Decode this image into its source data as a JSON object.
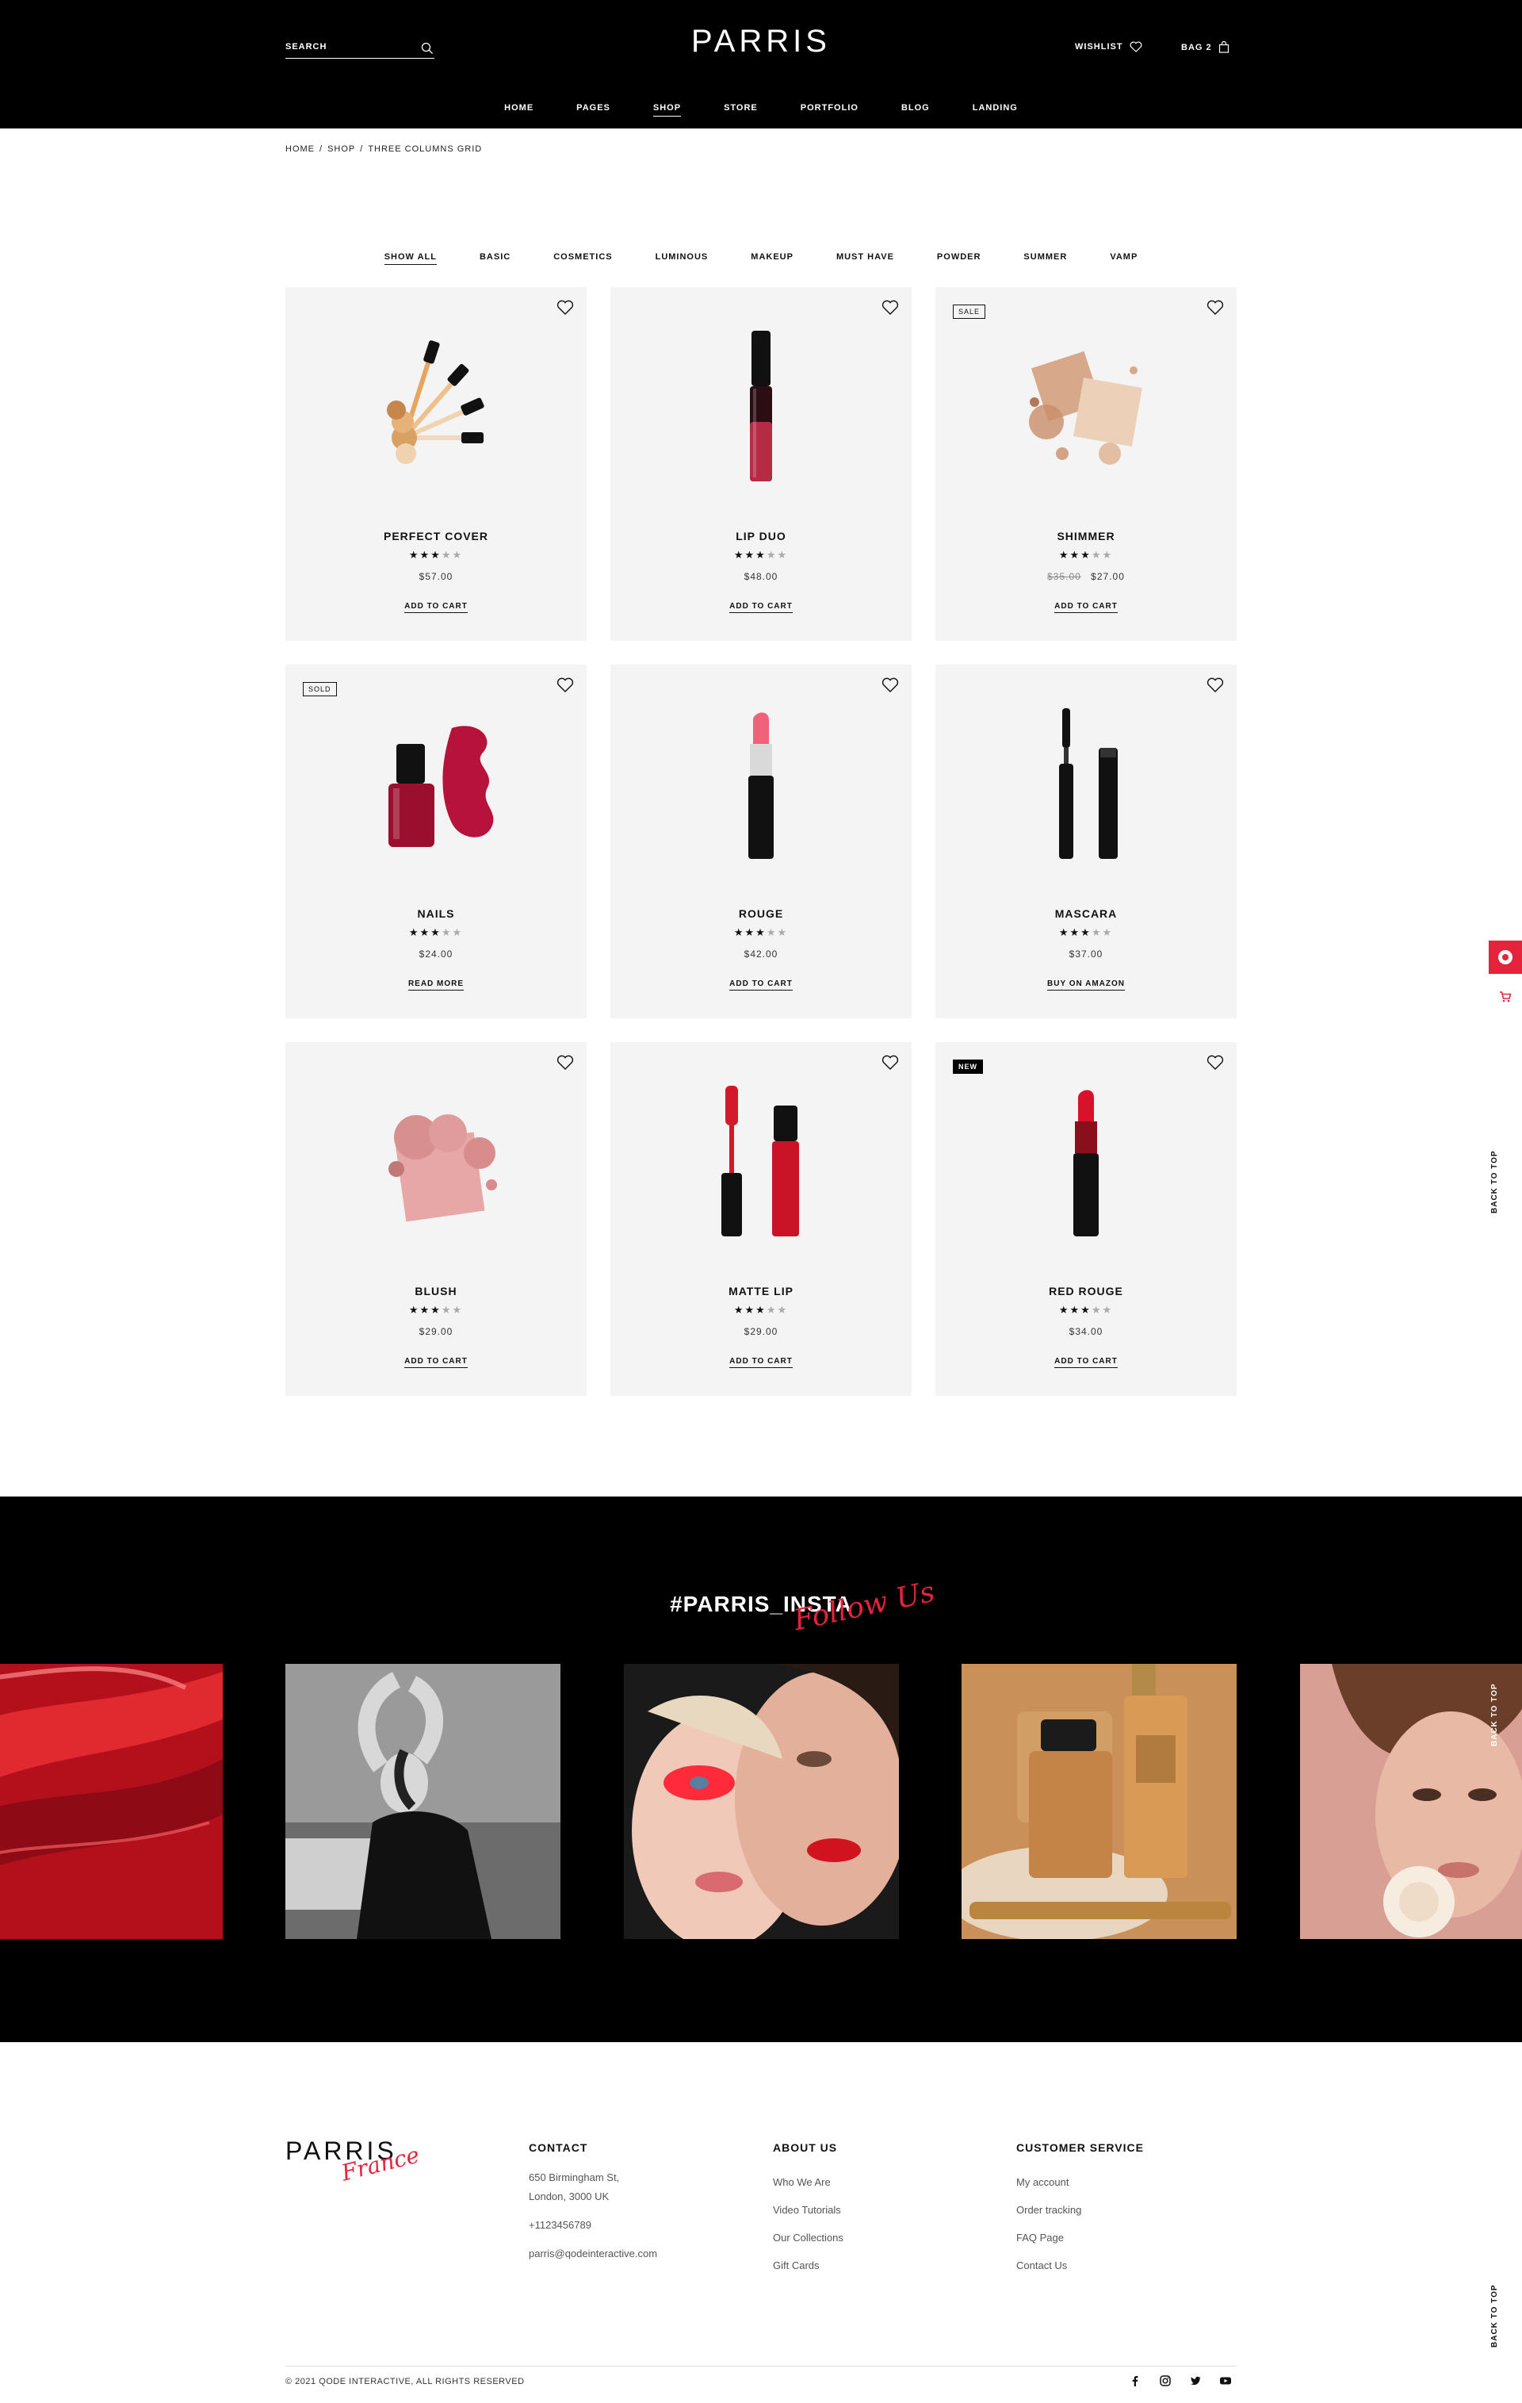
{
  "header": {
    "search_label": "SEARCH",
    "logo": "PARRIS",
    "wishlist_label": "WISHLIST",
    "bag_label": "BAG 2",
    "nav": [
      {
        "label": "HOME",
        "active": false
      },
      {
        "label": "PAGES",
        "active": false
      },
      {
        "label": "SHOP",
        "active": true
      },
      {
        "label": "STORE",
        "active": false
      },
      {
        "label": "PORTFOLIO",
        "active": false
      },
      {
        "label": "BLOG",
        "active": false
      },
      {
        "label": "LANDING",
        "active": false
      }
    ]
  },
  "breadcrumb": [
    "HOME",
    "SHOP",
    "THREE COLUMNS GRID"
  ],
  "filters": [
    {
      "label": "SHOW ALL",
      "active": true
    },
    {
      "label": "BASIC",
      "active": false
    },
    {
      "label": "COSMETICS",
      "active": false
    },
    {
      "label": "LUMINOUS",
      "active": false
    },
    {
      "label": "MAKEUP",
      "active": false
    },
    {
      "label": "MUST HAVE",
      "active": false
    },
    {
      "label": "POWDER",
      "active": false
    },
    {
      "label": "SUMMER",
      "active": false
    },
    {
      "label": "VAMP",
      "active": false
    }
  ],
  "products": [
    {
      "name": "PERFECT COVER",
      "rating": 3,
      "price": "$57.00",
      "old_price": "",
      "action": "ADD TO CART",
      "badge": "",
      "image": "droppers"
    },
    {
      "name": "LIP DUO",
      "rating": 3,
      "price": "$48.00",
      "old_price": "",
      "action": "ADD TO CART",
      "badge": "",
      "image": "lipgloss"
    },
    {
      "name": "SHIMMER",
      "rating": 3,
      "price": "$27.00",
      "old_price": "$35.00",
      "action": "ADD TO CART",
      "badge": "SALE",
      "image": "powder"
    },
    {
      "name": "NAILS",
      "rating": 3,
      "price": "$24.00",
      "old_price": "",
      "action": "READ MORE",
      "badge": "SOLD",
      "image": "nailpolish"
    },
    {
      "name": "ROUGE",
      "rating": 3,
      "price": "$42.00",
      "old_price": "",
      "action": "ADD TO CART",
      "badge": "",
      "image": "lipstick-pink"
    },
    {
      "name": "MASCARA",
      "rating": 3,
      "price": "$37.00",
      "old_price": "",
      "action": "BUY ON AMAZON",
      "badge": "",
      "image": "mascara"
    },
    {
      "name": "BLUSH",
      "rating": 3,
      "price": "$29.00",
      "old_price": "",
      "action": "ADD TO CART",
      "badge": "",
      "image": "blush"
    },
    {
      "name": "MATTE LIP",
      "rating": 3,
      "price": "$29.00",
      "old_price": "",
      "action": "ADD TO CART",
      "badge": "",
      "image": "mattelip"
    },
    {
      "name": "RED ROUGE",
      "rating": 3,
      "price": "$34.00",
      "old_price": "",
      "action": "ADD TO CART",
      "badge": "NEW",
      "image": "lipstick-red"
    }
  ],
  "side": {
    "back_to_top": "BACK TO TOP"
  },
  "insta": {
    "title": "#PARRIS_INSTA",
    "script": "Follow Us",
    "tiles": [
      "red-swatch",
      "dancer-bw",
      "two-models",
      "foundation-bottles",
      "model-rose"
    ]
  },
  "footer": {
    "logo": "PARRIS",
    "logo_script": "France",
    "contact": {
      "title": "CONTACT",
      "address_line1": "650 Birmingham St,",
      "address_line2": "London, 3000 UK",
      "phone": "+1123456789",
      "email": "parris@qodeinteractive.com"
    },
    "about": {
      "title": "ABOUT US",
      "links": [
        "Who We Are",
        "Video Tutorials",
        "Our Collections",
        "Gift Cards"
      ]
    },
    "service": {
      "title": "CUSTOMER SERVICE",
      "links": [
        "My account",
        "Order tracking",
        "FAQ Page",
        "Contact Us"
      ]
    },
    "copyright": "© 2021 QODE INTERACTIVE, ALL RIGHTS RESERVED",
    "socials": [
      "facebook-icon",
      "instagram-icon",
      "twitter-icon",
      "youtube-icon"
    ]
  },
  "colors": {
    "accent": "#e5233a",
    "dark": "#000000",
    "card_bg": "#f4f4f4"
  }
}
